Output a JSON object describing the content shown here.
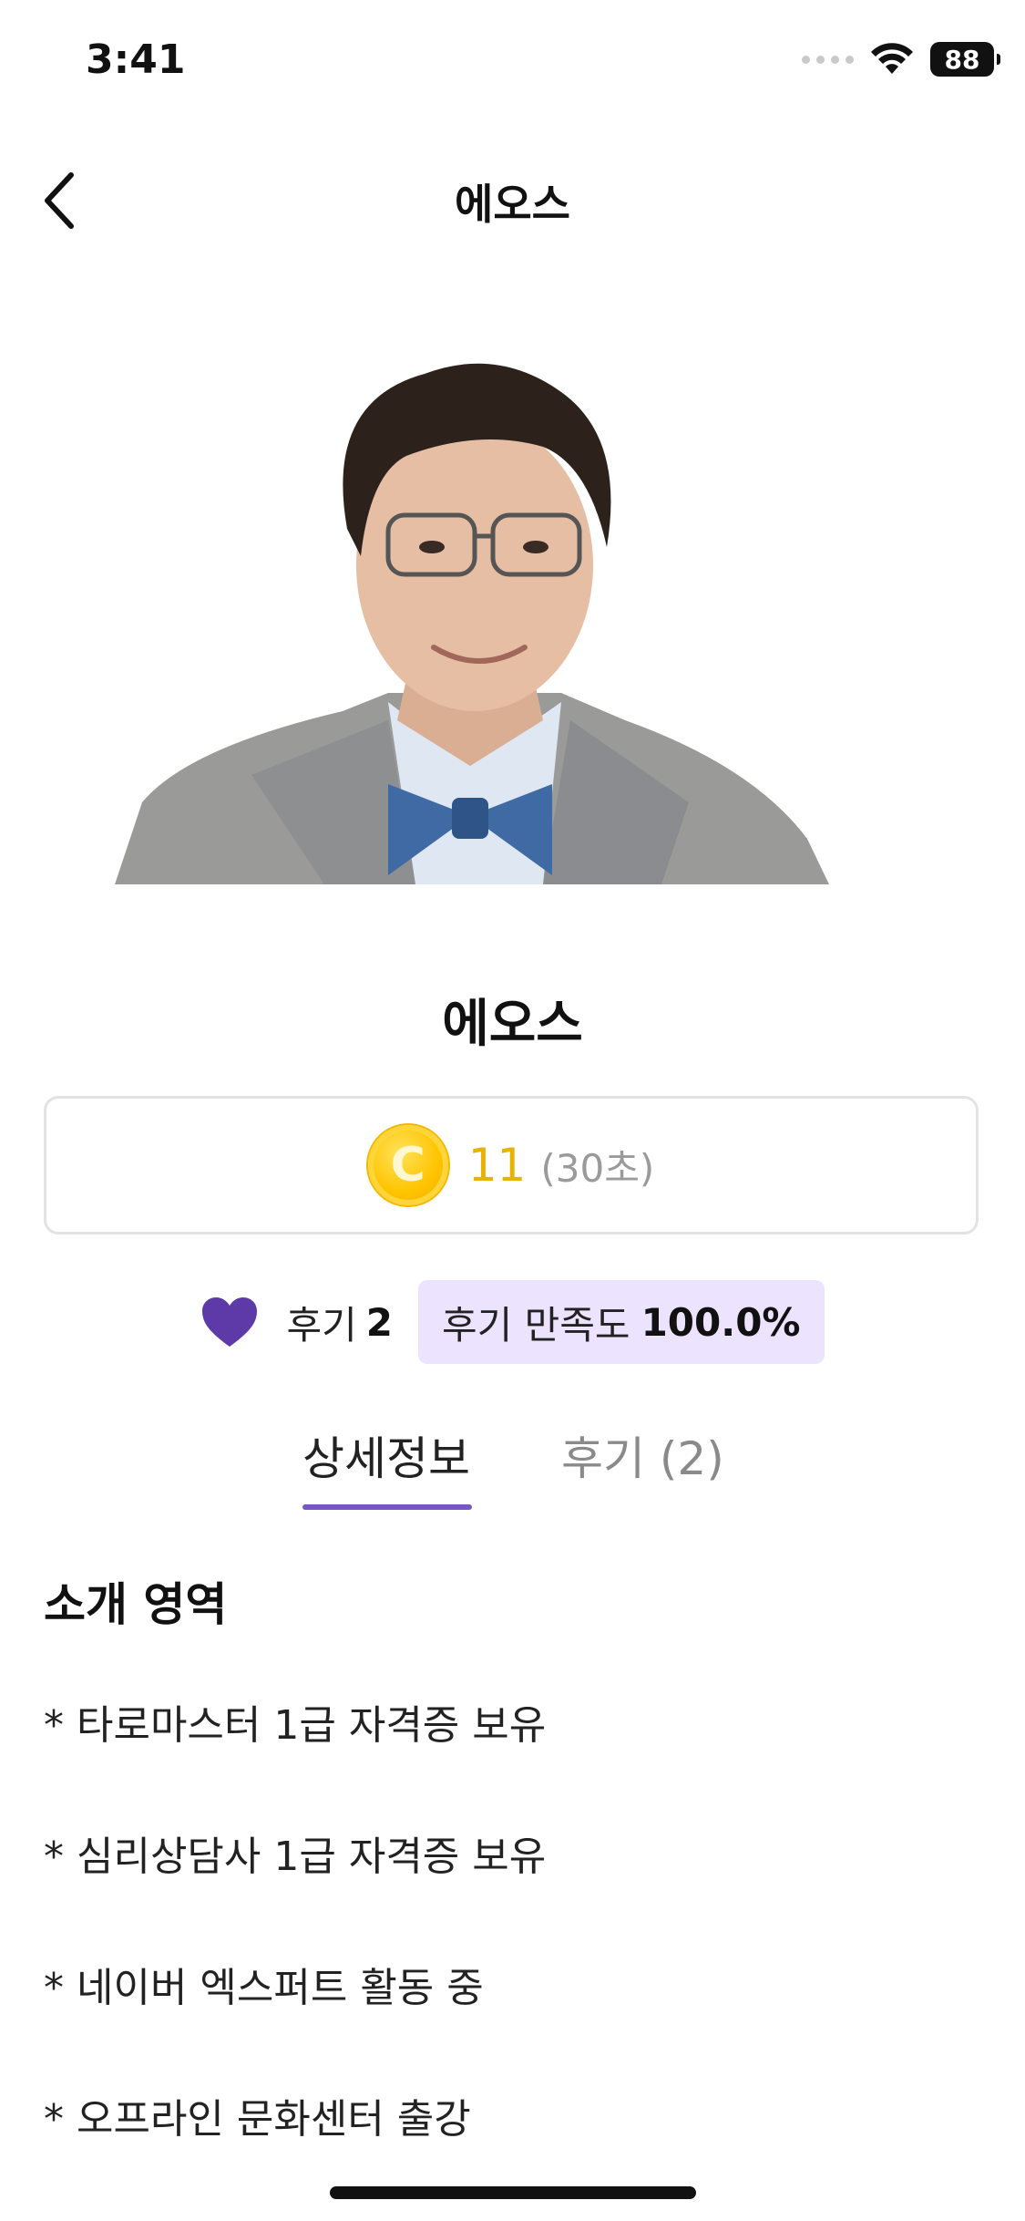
{
  "status_bar": {
    "time": "3:41",
    "battery": "88"
  },
  "header": {
    "title": "에오스",
    "back_icon": "chevron-left-icon"
  },
  "profile": {
    "name": "에오스",
    "price": {
      "coin_symbol": "C",
      "amount": "11",
      "unit": "(30초)"
    },
    "reviews": {
      "label": "후기",
      "count": "2",
      "satisfaction_label": "후기 만족도",
      "satisfaction_value": "100.0%"
    }
  },
  "tabs": [
    {
      "label": "상세정보",
      "active": true
    },
    {
      "label": "후기 (2)",
      "active": false
    }
  ],
  "intro": {
    "title": "소개 영역",
    "items": [
      "* 타로마스터 1급 자격증 보유",
      "* 심리상담사 1급 자격증 보유",
      "* 네이버 엑스퍼트 활동 중",
      "* 오프라인 문화센터 출강"
    ]
  },
  "colors": {
    "accent_purple": "#7b57c2",
    "heart": "#5d3aa8",
    "badge_bg": "#ece3ff",
    "coin": "#ffc400"
  }
}
